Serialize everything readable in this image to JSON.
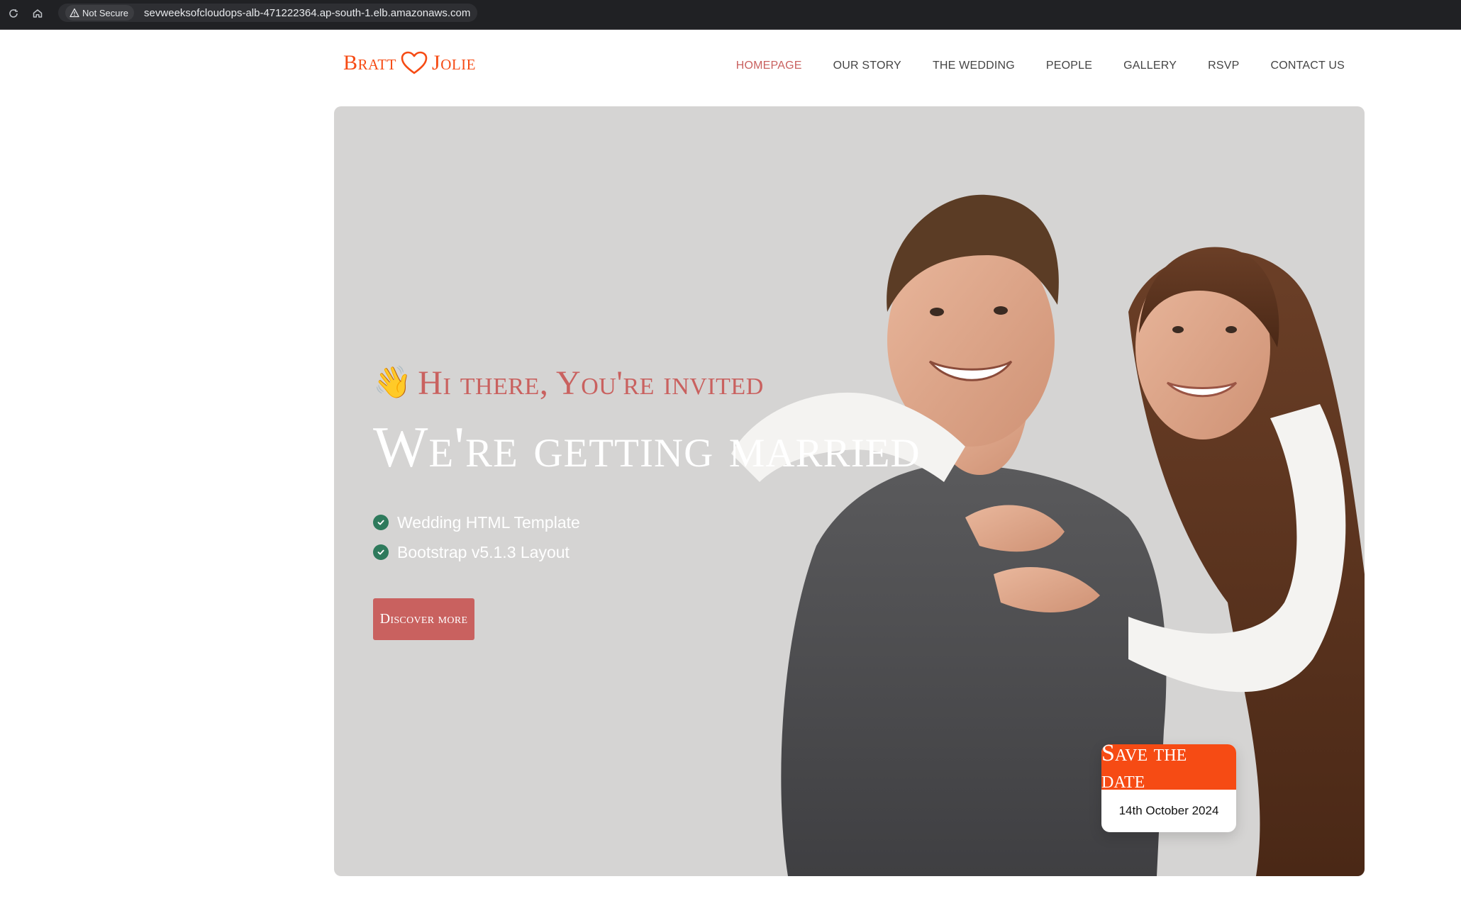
{
  "browser": {
    "security_label": "Not Secure",
    "url": "sevweeksofcloudops-alb-471222364.ap-south-1.elb.amazonaws.com"
  },
  "site": {
    "brand": {
      "left": "Bratt",
      "right": "Jolie",
      "icon": "heart-outline-icon",
      "color": "#f64b14"
    },
    "nav": [
      {
        "label": "HOMEPAGE",
        "active": true
      },
      {
        "label": "OUR STORY",
        "active": false
      },
      {
        "label": "THE WEDDING",
        "active": false
      },
      {
        "label": "PEOPLE",
        "active": false
      },
      {
        "label": "GALLERY",
        "active": false
      },
      {
        "label": "RSVP",
        "active": false
      },
      {
        "label": "CONTACT US",
        "active": false
      }
    ]
  },
  "hero": {
    "wave_emoji": "👋",
    "greeting": "Hi there, You're invited",
    "headline": "We're getting married",
    "features": [
      "Wedding HTML Template",
      "Bootstrap v5.1.3 Layout"
    ],
    "cta_label": "Discover more",
    "save_the_date": {
      "title": "Save the date",
      "date": "14th October 2024"
    },
    "colors": {
      "background": "#d5d4d3",
      "accent": "#c9615f",
      "check": "#2e7a5c",
      "orange": "#f64b14"
    }
  }
}
